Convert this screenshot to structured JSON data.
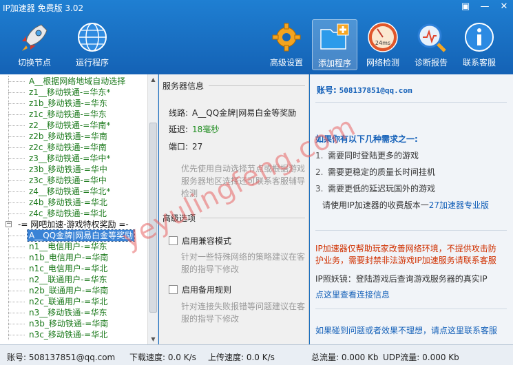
{
  "window": {
    "title": "IP加速器 免费版 3.02",
    "buttons": [
      "skin",
      "minimize",
      "close"
    ]
  },
  "toolbar": {
    "left": [
      {
        "label": "切换节点",
        "icon": "rocket-icon"
      },
      {
        "label": "运行程序",
        "icon": "globe-icon"
      }
    ],
    "right": [
      {
        "label": "高级设置",
        "icon": "gear-icon"
      },
      {
        "label": "添加程序",
        "icon": "add-folder-icon",
        "active": true
      },
      {
        "label": "网络检测",
        "icon": "speedometer-icon",
        "badge": "24ms"
      },
      {
        "label": "诊断报告",
        "icon": "diagnostic-icon"
      },
      {
        "label": "联系客服",
        "icon": "info-icon"
      }
    ]
  },
  "tree": {
    "items": [
      {
        "label": "A__根据网络地域自动选择",
        "type": "node"
      },
      {
        "label": "z1__移动铁通-=华东*",
        "type": "node"
      },
      {
        "label": "z1b_移动铁通-=华东",
        "type": "node"
      },
      {
        "label": "z1c_移动铁通-=华东",
        "type": "node"
      },
      {
        "label": "z2__移动铁通-=华南*",
        "type": "node"
      },
      {
        "label": "z2b_移动铁通-=华南",
        "type": "node"
      },
      {
        "label": "z2c_移动铁通-=华南",
        "type": "node"
      },
      {
        "label": "z3__移动铁通-=华中*",
        "type": "node"
      },
      {
        "label": "z3b_移动铁通-=华中",
        "type": "node"
      },
      {
        "label": "z3c_移动铁通-=华中",
        "type": "node"
      },
      {
        "label": "z4__移动铁通-=华北*",
        "type": "node"
      },
      {
        "label": "z4b_移动铁通-=华北",
        "type": "node"
      },
      {
        "label": "z4c_移动铁通-=华北",
        "type": "node"
      },
      {
        "label": "-= 网吧加速-游戏特权奖励 =-",
        "type": "group",
        "expander": "−"
      },
      {
        "label": "A__QQ金牌|网易白金等奖励",
        "type": "node",
        "selected": true
      },
      {
        "label": "n1__电信用户-=华东",
        "type": "node"
      },
      {
        "label": "n1b_电信用户-=华南",
        "type": "node"
      },
      {
        "label": "n1c_电信用户-=华北",
        "type": "node"
      },
      {
        "label": "n2__联通用户-=华东",
        "type": "node"
      },
      {
        "label": "n2b_联通用户-=华南",
        "type": "node"
      },
      {
        "label": "n2c_联通用户-=华北",
        "type": "node"
      },
      {
        "label": "n3__移动铁通-=华东",
        "type": "node"
      },
      {
        "label": "n3b_移动铁通-=华南",
        "type": "node"
      },
      {
        "label": "n3c_移动铁通-=华北",
        "type": "node"
      }
    ]
  },
  "server_info": {
    "section_title": "服务器信息",
    "line_label": "线路:",
    "line_value": "A__QQ金牌|网易白金等奖励",
    "latency_label": "延迟:",
    "latency_value": "18毫秒",
    "port_label": "端口:",
    "port_value": "27",
    "hint": "优先使用自动选择节点或根据游戏服务器地区选择还可联系客服辅导检测"
  },
  "advanced": {
    "section_title": "高级选项",
    "compat_label": "启用兼容模式",
    "compat_hint": "针对一些特殊网络的策略建议在客服的指导下修改",
    "backup_label": "启用备用规则",
    "backup_hint": "针对连接失败报错等问题建议在客服的指导下修改"
  },
  "account_panel": {
    "account_label": "账号:",
    "account_value": "508137851@qq.com",
    "needs_title": "如果你有以下几种需求之一:",
    "needs": [
      {
        "num": "1.",
        "text": "需要同时登陆更多的游戏"
      },
      {
        "num": "2.",
        "text": "需要更稳定的质量长时间挂机"
      },
      {
        "num": "3.",
        "text": "需要更低的延迟玩国外的游戏"
      }
    ],
    "promo_text": "请使用IP加速器的收费版本一",
    "promo_link": "27加速器专业版",
    "warning": "IP加速器仅帮助玩家改善网络环境，不提供攻击防护业务，需要封禁非法游戏IP加速服务请联系客服",
    "ip_tip": "IP照妖镜：登陆游戏后查询游戏服务器的真实IP",
    "check_link": "点这里查看连接信息",
    "support_link": "如果碰到问题或者效果不理想，请点这里联系客服"
  },
  "statusbar": {
    "account": "账号: 508137851@qq.com",
    "download": "下载速度: 0.0 K/s",
    "upload": "上传速度: 0.0 K/s",
    "total": "总流量: 0.000 Kb",
    "udp": "UDP流量: 0.000 Kb"
  },
  "watermark": "yeyulingfeng.com",
  "colors": {
    "toolbar": "#1767b8",
    "tree_text": "#1c7a1c",
    "selection": "#3a83d6",
    "link": "#1460b8",
    "warning": "#d03000"
  }
}
